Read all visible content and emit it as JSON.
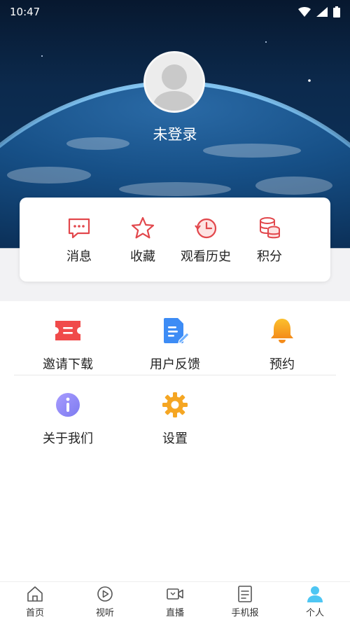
{
  "status_bar": {
    "time": "10:47"
  },
  "profile": {
    "login_label": "未登录"
  },
  "quick_actions": [
    {
      "label": "消息",
      "icon": "message-icon"
    },
    {
      "label": "收藏",
      "icon": "star-icon"
    },
    {
      "label": "观看历史",
      "icon": "history-icon"
    },
    {
      "label": "积分",
      "icon": "coins-icon"
    }
  ],
  "grid": [
    {
      "label": "邀请下载",
      "icon": "ticket-icon"
    },
    {
      "label": "用户反馈",
      "icon": "feedback-icon"
    },
    {
      "label": "预约",
      "icon": "bell-icon"
    },
    {
      "label": "关于我们",
      "icon": "info-icon"
    },
    {
      "label": "设置",
      "icon": "gear-icon"
    }
  ],
  "tabs": [
    {
      "label": "首页",
      "icon": "home-icon"
    },
    {
      "label": "视听",
      "icon": "play-icon"
    },
    {
      "label": "直播",
      "icon": "camera-icon"
    },
    {
      "label": "手机报",
      "icon": "document-icon"
    },
    {
      "label": "个人",
      "icon": "person-icon",
      "active": true
    }
  ],
  "colors": {
    "quick_icon_red": "#e2474c",
    "ticket_red": "#f04a4a",
    "feedback_blue": "#3d8cf5",
    "bell_orange": "#f7a21b",
    "info_purple": "#8d87f5",
    "gear_orange": "#f5a623",
    "tab_active": "#4ec6f3",
    "tab_inactive": "#555555"
  }
}
